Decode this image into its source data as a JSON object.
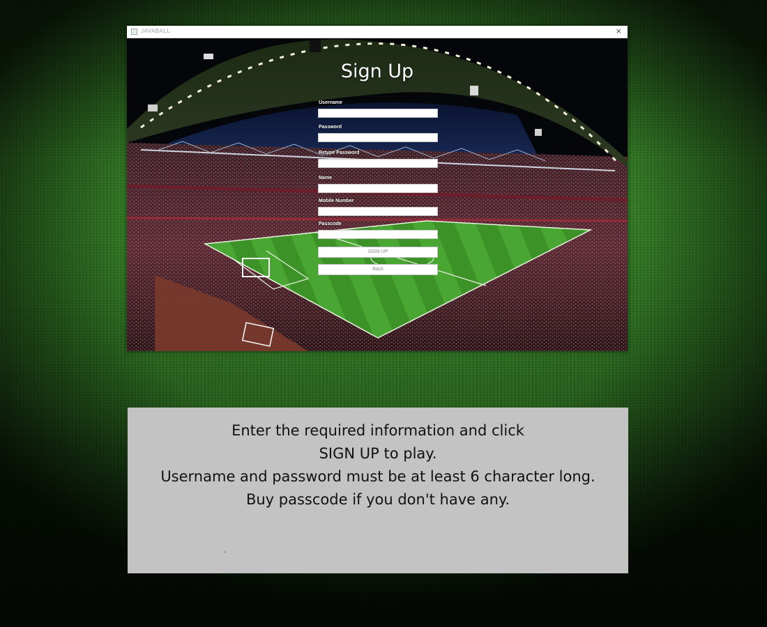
{
  "window": {
    "title": "JAVABALL",
    "close_glyph": "×"
  },
  "form": {
    "heading": "Sign Up",
    "fields": [
      {
        "label": "Username",
        "value": ""
      },
      {
        "label": "Password",
        "value": ""
      },
      {
        "label": "Retype Password",
        "value": ""
      },
      {
        "label": "Name",
        "value": ""
      },
      {
        "label": "Mobile Number",
        "value": ""
      },
      {
        "label": "Passcode",
        "value": ""
      }
    ],
    "signup_label": "SIGN UP",
    "back_label": "Back"
  },
  "info": {
    "lines": [
      "Enter the required information and click",
      "SIGN UP to play.",
      "Username and password must be at least  6 character long.",
      "Buy passcode if you don't have any."
    ],
    "dot": "."
  },
  "icons": {
    "app": "java-app-icon",
    "close": "close-icon"
  },
  "colors": {
    "info_panel_bg": "#c3c3c3",
    "pitch_green": "#3f9a2e",
    "stadium_dark": "#05070c"
  }
}
